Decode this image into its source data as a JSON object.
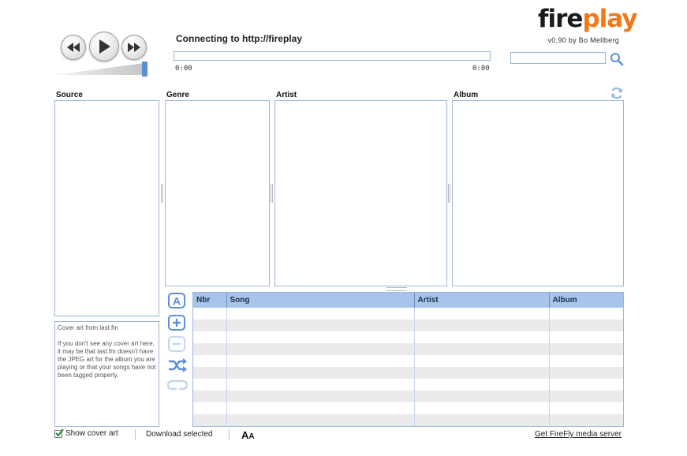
{
  "player": {
    "status": "Connecting to http://fireplay",
    "time_elapsed": "0:00",
    "time_total": "0:00",
    "volume": 1.0
  },
  "brand": {
    "logo_fire": "fire",
    "logo_play": "play",
    "version": "v0.90 by Bo Mellberg",
    "fire_color": "#1a1a1a",
    "play_color": "#f07a1a"
  },
  "search": {
    "value": "",
    "placeholder": ""
  },
  "panes": {
    "source": "Source",
    "genre": "Genre",
    "artist": "Artist",
    "album": "Album"
  },
  "cover": {
    "title": "Cover art from last.fm",
    "message": "If you don't see any cover art here, it may be that last.fm doesn't have the JPEG art for the album you are playing or that your songs have not been tagged properly."
  },
  "songs": {
    "columns": [
      "Nbr",
      "Song",
      "Artist",
      "Album"
    ],
    "row_count": 10
  },
  "footer": {
    "show_cover_art": "Show cover art",
    "show_cover_art_checked": true,
    "download_selected": "Download selected",
    "font_size_glyph": "A",
    "font_size_glyph_small": "A",
    "get_firefly": "Get FireFly media server"
  },
  "colors": {
    "accent": "#5b8fd8",
    "border": "#9fb6d6",
    "header": "#a8c4ea"
  }
}
